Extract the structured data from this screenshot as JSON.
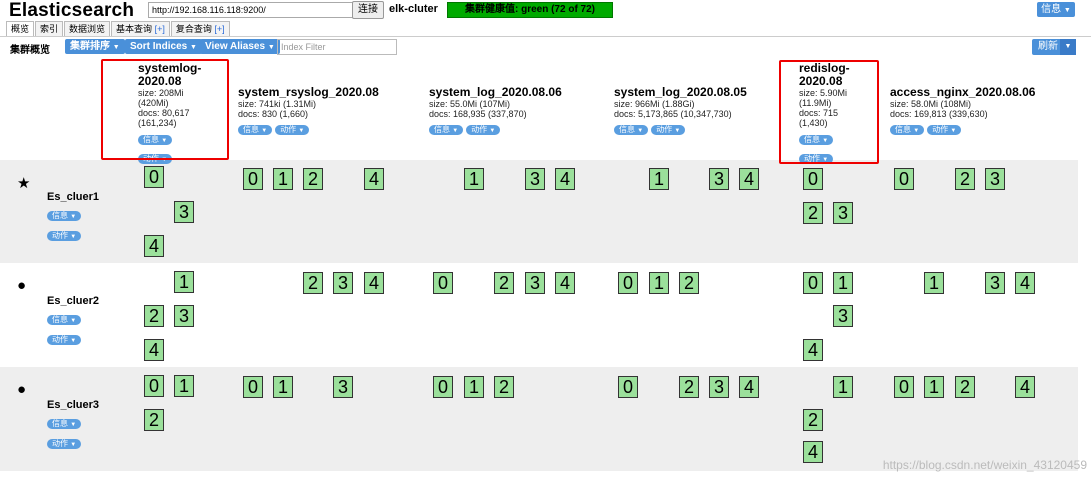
{
  "header": {
    "app_title": "Elasticsearch",
    "url": "http://192.168.116.118:9200/",
    "connect_label": "连接",
    "cluster_name": "elk-cluter",
    "health": "集群健康值: green (72 of 72)",
    "info_label": "信息"
  },
  "tabs": [
    {
      "label": "概览"
    },
    {
      "label": "索引"
    },
    {
      "label": "数据浏览"
    },
    {
      "label": "基本查询",
      "plus": "[+]"
    },
    {
      "label": "复合查询",
      "plus": "[+]"
    }
  ],
  "toolbar": {
    "overview_label": "集群概览",
    "cluster_sort": "集群排序",
    "sort_indices": "Sort Indices",
    "view_aliases": "View Aliases",
    "index_filter_placeholder": "Index Filter",
    "refresh_label": "刷新"
  },
  "pills": {
    "info": "信息",
    "action": "动作"
  },
  "indices": [
    {
      "name_line1": "systemlog-",
      "name_line2": "2020.08",
      "size": "size: 208Mi",
      "size2": "(420Mi)",
      "docs": "docs: 80,617",
      "docs2": "(161,234)"
    },
    {
      "name_line1": "system_rsyslog_2020.08",
      "size": "size: 741ki (1.31Mi)",
      "docs": "docs: 830 (1,660)"
    },
    {
      "name_line1": "system_log_2020.08.06",
      "size": "size: 55.0Mi (107Mi)",
      "docs": "docs: 168,935 (337,870)"
    },
    {
      "name_line1": "system_log_2020.08.05",
      "size": "size: 966Mi (1.88Gi)",
      "docs": "docs: 5,173,865 (10,347,730)"
    },
    {
      "name_line1": "redislog-",
      "name_line2": "2020.08",
      "size": "size: 5.90Mi",
      "size2": "(11.9Mi)",
      "docs": "docs: 715",
      "docs2": "(1,430)"
    },
    {
      "name_line1": "access_nginx_2020.08.06",
      "size": "size: 58.0Mi (108Mi)",
      "docs": "docs: 169,813 (339,630)"
    }
  ],
  "nodes": [
    {
      "icon": "★",
      "name": "Es_cluer1"
    },
    {
      "icon": "●",
      "name": "Es_cluer2"
    },
    {
      "icon": "●",
      "name": "Es_cluer3"
    }
  ],
  "shards": {
    "n1": [
      [
        "0",
        "3",
        "4"
      ],
      [
        "0",
        "1",
        "2",
        "4"
      ],
      [
        "1",
        "3",
        "4"
      ],
      [
        "1",
        "3",
        "4"
      ],
      [
        "0",
        "2",
        "3"
      ],
      [
        "0",
        "2",
        "3"
      ]
    ],
    "n2": [
      [
        "1",
        "2",
        "3",
        "4"
      ],
      [
        "2",
        "3",
        "4"
      ],
      [
        "0",
        "2",
        "3",
        "4"
      ],
      [
        "0",
        "1",
        "2"
      ],
      [
        "0",
        "1",
        "3",
        "4"
      ],
      [
        "1",
        "3",
        "4"
      ]
    ],
    "n3": [
      [
        "0",
        "1",
        "2"
      ],
      [
        "0",
        "1",
        "3"
      ],
      [
        "0",
        "1",
        "2"
      ],
      [
        "0",
        "2",
        "3",
        "4"
      ],
      [
        "1",
        "2",
        "4"
      ],
      [
        "0",
        "1",
        "2",
        "4"
      ]
    ]
  },
  "watermark": "https://blog.csdn.net/weixin_43120459"
}
